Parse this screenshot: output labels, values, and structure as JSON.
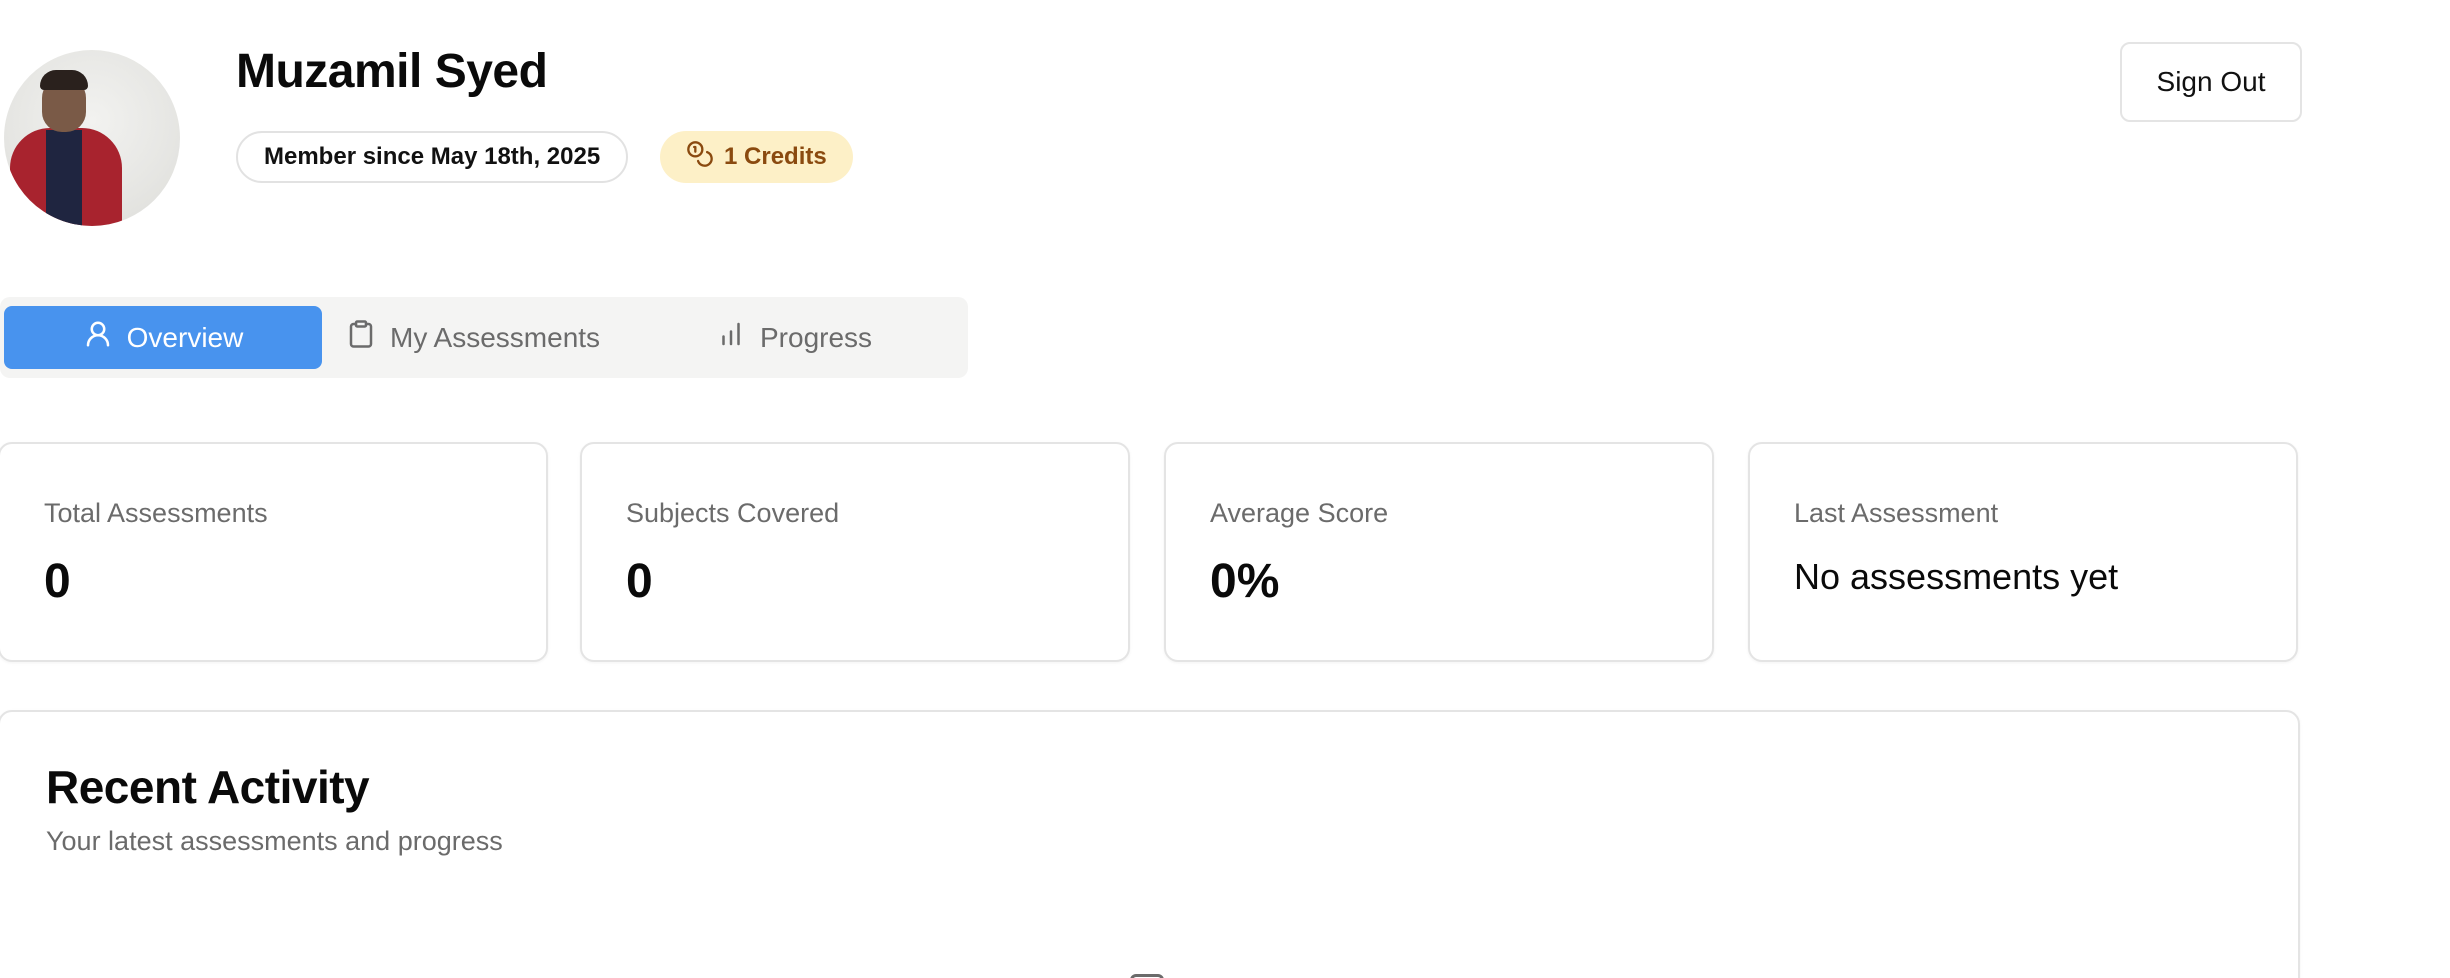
{
  "profile": {
    "name": "Muzamil Syed",
    "member_since": "Member since May 18th, 2025",
    "credits": "1 Credits",
    "avatar_alt": "avatar"
  },
  "header": {
    "sign_out_label": "Sign Out"
  },
  "tabs": [
    {
      "label": "Overview",
      "icon": "user-icon",
      "active": true
    },
    {
      "label": "My Assessments",
      "icon": "clipboard-icon",
      "active": false
    },
    {
      "label": "Progress",
      "icon": "bar-chart-icon",
      "active": false
    }
  ],
  "stats": [
    {
      "label": "Total Assessments",
      "value": "0"
    },
    {
      "label": "Subjects Covered",
      "value": "0"
    },
    {
      "label": "Average Score",
      "value": "0%"
    },
    {
      "label": "Last Assessment",
      "value": "No assessments yet"
    }
  ],
  "activity": {
    "title": "Recent Activity",
    "subtitle": "Your latest assessments and progress"
  },
  "colors": {
    "accent": "#4893ee",
    "credits_bg": "#fdf0c7",
    "credits_text": "#8a4a0f",
    "muted_text": "#6b6b6b",
    "border": "#e4e4e4"
  }
}
